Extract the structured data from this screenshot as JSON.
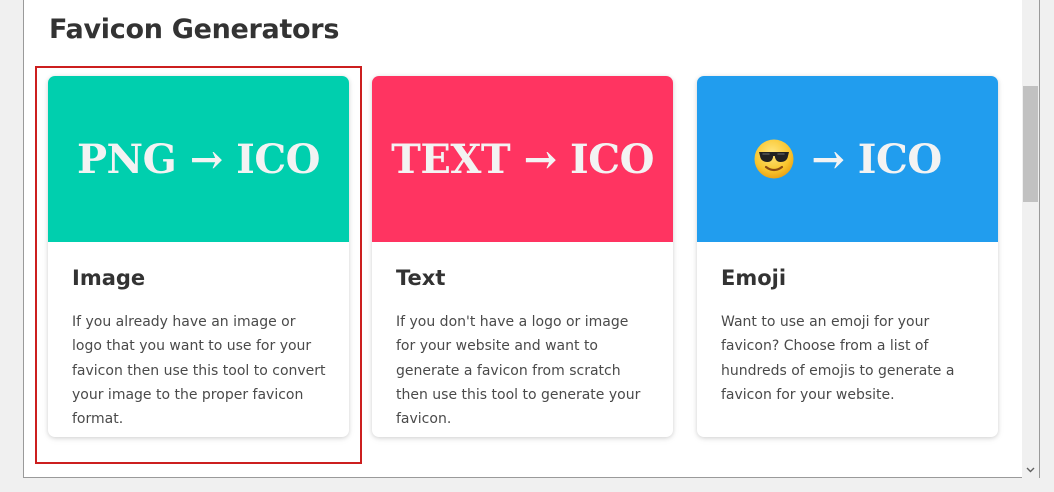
{
  "page": {
    "heading": "Favicon Generators"
  },
  "cards": [
    {
      "banner_text": "PNG → ICO",
      "banner_color": "#00cfae",
      "title": "Image",
      "description": "If you already have an image or logo that you want to use for your favicon then use this tool to convert your image to the proper favicon format."
    },
    {
      "banner_text": "TEXT → ICO",
      "banner_color": "#ff3461",
      "title": "Text",
      "description": "If you don't have a logo or image for your website and want to generate a favicon from scratch then use this tool to generate your favicon."
    },
    {
      "banner_emoji": "smiling-face-with-sunglasses-icon",
      "banner_text": "→ ICO",
      "banner_color": "#219dee",
      "title": "Emoji",
      "description": "Want to use an emoji for your favicon? Choose from a list of hundreds of emojis to generate a favicon for your website."
    }
  ],
  "colors": {
    "highlight_border": "#cc1f1f",
    "heading_text": "#333333"
  }
}
